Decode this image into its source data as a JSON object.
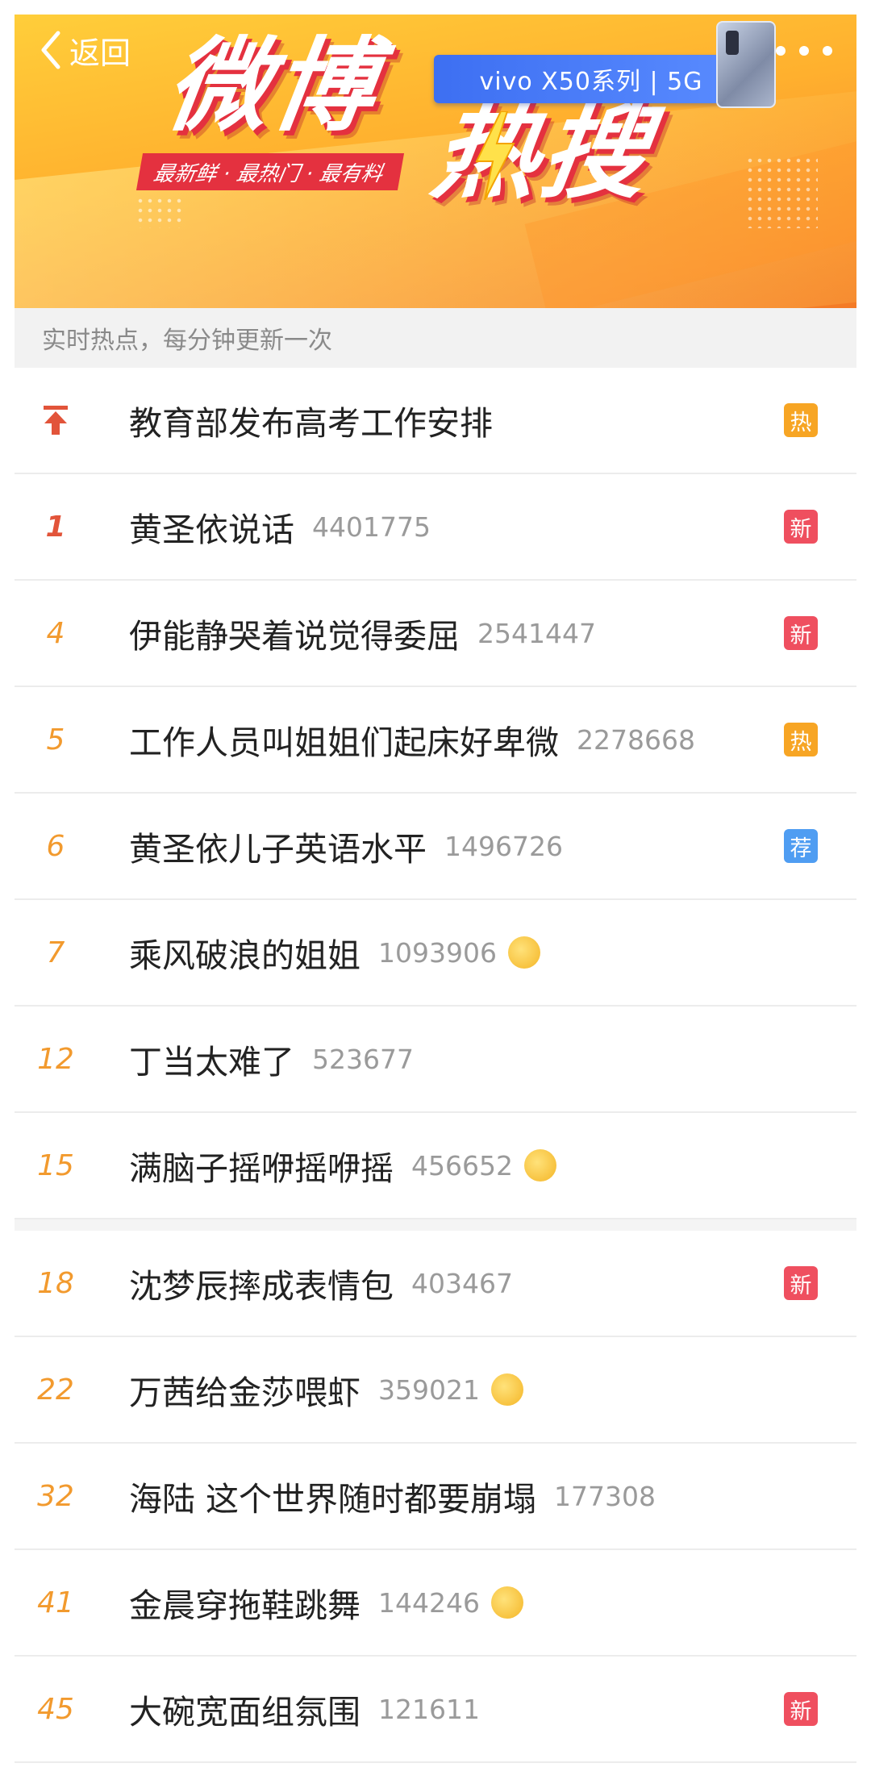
{
  "header": {
    "back_label": "返回",
    "logo_part1": "微博",
    "logo_part2": "热搜",
    "slogan": "最新鲜 · 最热门 · 最有料",
    "ad_text": "vivo X50系列 | 5G"
  },
  "info_bar": "实时热点，每分钟更新一次",
  "items": [
    {
      "rank": "",
      "title": "教育部发布高考工作安排",
      "count": "",
      "badge": "热"
    },
    {
      "rank": "1",
      "title": "黄圣依说话",
      "count": "4401775",
      "badge": "新"
    },
    {
      "rank": "4",
      "title": "伊能静哭着说觉得委屈",
      "count": "2541447",
      "badge": "新"
    },
    {
      "rank": "5",
      "title": "工作人员叫姐姐们起床好卑微",
      "count": "2278668",
      "badge": "热"
    },
    {
      "rank": "6",
      "title": "黄圣依儿子英语水平",
      "count": "1496726",
      "badge": "荐"
    },
    {
      "rank": "7",
      "title": "乘风破浪的姐姐",
      "count": "1093906",
      "emoji": "laugh-cry-emoji"
    },
    {
      "rank": "12",
      "title": "丁当太难了",
      "count": "523677"
    },
    {
      "rank": "15",
      "title": "满脑子摇咿摇咿摇",
      "count": "456652",
      "emoji": "laugh-cry-emoji"
    },
    {
      "rank": "18",
      "title": "沈梦辰摔成表情包",
      "count": "403467",
      "badge": "新"
    },
    {
      "rank": "22",
      "title": "万茜给金莎喂虾",
      "count": "359021",
      "emoji": "doge-emoji"
    },
    {
      "rank": "32",
      "title": "海陆 这个世界随时都要崩塌",
      "count": "177308"
    },
    {
      "rank": "41",
      "title": "金晨穿拖鞋跳舞",
      "count": "144246",
      "emoji": "laugh-emoji"
    },
    {
      "rank": "45",
      "title": "大碗宽面组氛围",
      "count": "121611",
      "badge": "新"
    }
  ],
  "colors": {
    "rank": "#f29a2e",
    "top_rank": "#e2543a",
    "badge_hot": "#f7a524",
    "badge_new": "#ef4f5f",
    "badge_rec": "#4f9df2",
    "brand_red": "#e4313f"
  }
}
